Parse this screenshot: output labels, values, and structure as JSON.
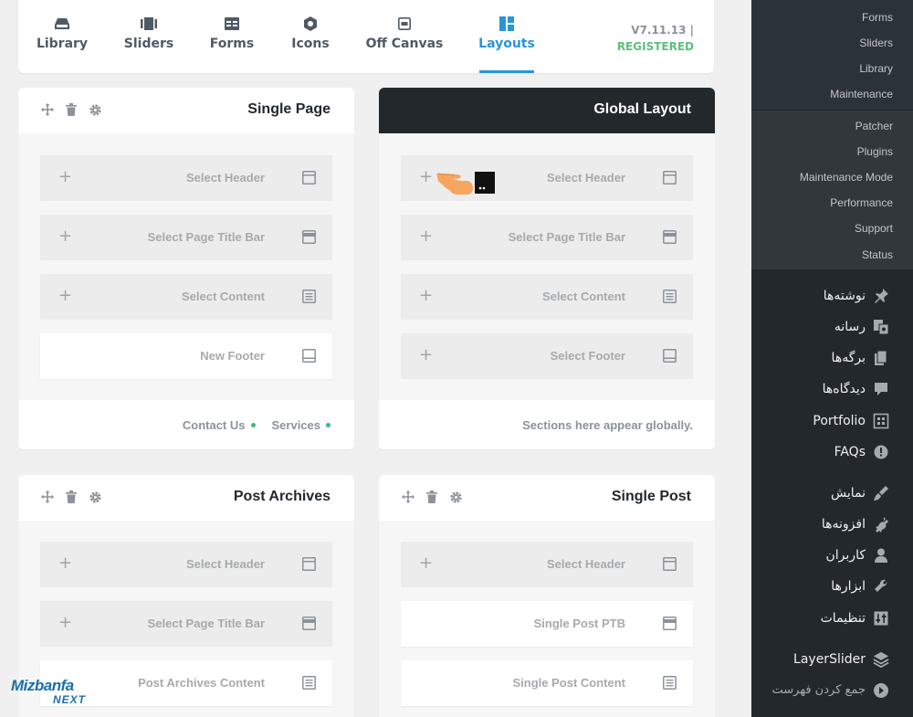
{
  "tabs": [
    {
      "label": "Library",
      "icon": "library-icon"
    },
    {
      "label": "Sliders",
      "icon": "sliders-icon"
    },
    {
      "label": "Forms",
      "icon": "forms-icon"
    },
    {
      "label": "Icons",
      "icon": "icons-icon"
    },
    {
      "label": "Off Canvas",
      "icon": "off-canvas-icon"
    },
    {
      "label": "Layouts",
      "icon": "layouts-icon",
      "active": true
    }
  ],
  "version": {
    "number": "V7.11.13 |",
    "status": "REGISTERED"
  },
  "colors": {
    "accent": "#2a95d6",
    "registered": "#5fbe7e",
    "dark_header": "#23282d",
    "dot": "#2fbd84"
  },
  "cards": {
    "single_page": {
      "title": "Single Page",
      "slots": [
        "Select Header",
        "Select Page Title Bar",
        "Select Content",
        "New Footer"
      ],
      "footer": [
        "Services",
        "Contact Us"
      ]
    },
    "global_layout": {
      "title": "Global Layout",
      "slots": [
        "Select Header",
        "Select Page Title Bar",
        "Select Content",
        "Select Footer"
      ],
      "footer_note": "Sections here appear globally."
    },
    "post_archives": {
      "title": "Post Archives",
      "slots": [
        "Select Header",
        "Select Page Title Bar",
        "Post Archives Content"
      ]
    },
    "single_post": {
      "title": "Single Post",
      "slots": [
        "Select Header",
        "Single Post PTB",
        "Single Post Content"
      ]
    }
  },
  "sidebar": {
    "submenu_top": [
      "Forms",
      "Sliders",
      "Library",
      "Maintenance"
    ],
    "submenu_mid": [
      "Patcher",
      "Plugins",
      "Maintenance Mode",
      "Performance",
      "Support",
      "Status"
    ],
    "menu": [
      {
        "label": "نوشته‌ها",
        "icon": "pin-icon"
      },
      {
        "label": "رسانه",
        "icon": "media-icon"
      },
      {
        "label": "برگه‌ها",
        "icon": "pages-icon"
      },
      {
        "label": "دیدگاه‌ها",
        "icon": "comments-icon"
      },
      {
        "label": "Portfolio",
        "icon": "portfolio-icon"
      },
      {
        "label": "FAQs",
        "icon": "faq-icon"
      },
      {
        "label": "نمایش",
        "icon": "appearance-icon"
      },
      {
        "label": "افزونه‌ها",
        "icon": "plugins-icon"
      },
      {
        "label": "کاربران",
        "icon": "users-icon"
      },
      {
        "label": "ابزارها",
        "icon": "tools-icon"
      },
      {
        "label": "تنظیمات",
        "icon": "settings-icon"
      },
      {
        "label": "LayerSlider",
        "icon": "layerslider-icon"
      },
      {
        "label": "جمع کردن فهرست",
        "icon": "collapse-icon"
      }
    ]
  },
  "logo": {
    "line1": "Mizbanfa",
    "line2": "NEXT"
  }
}
